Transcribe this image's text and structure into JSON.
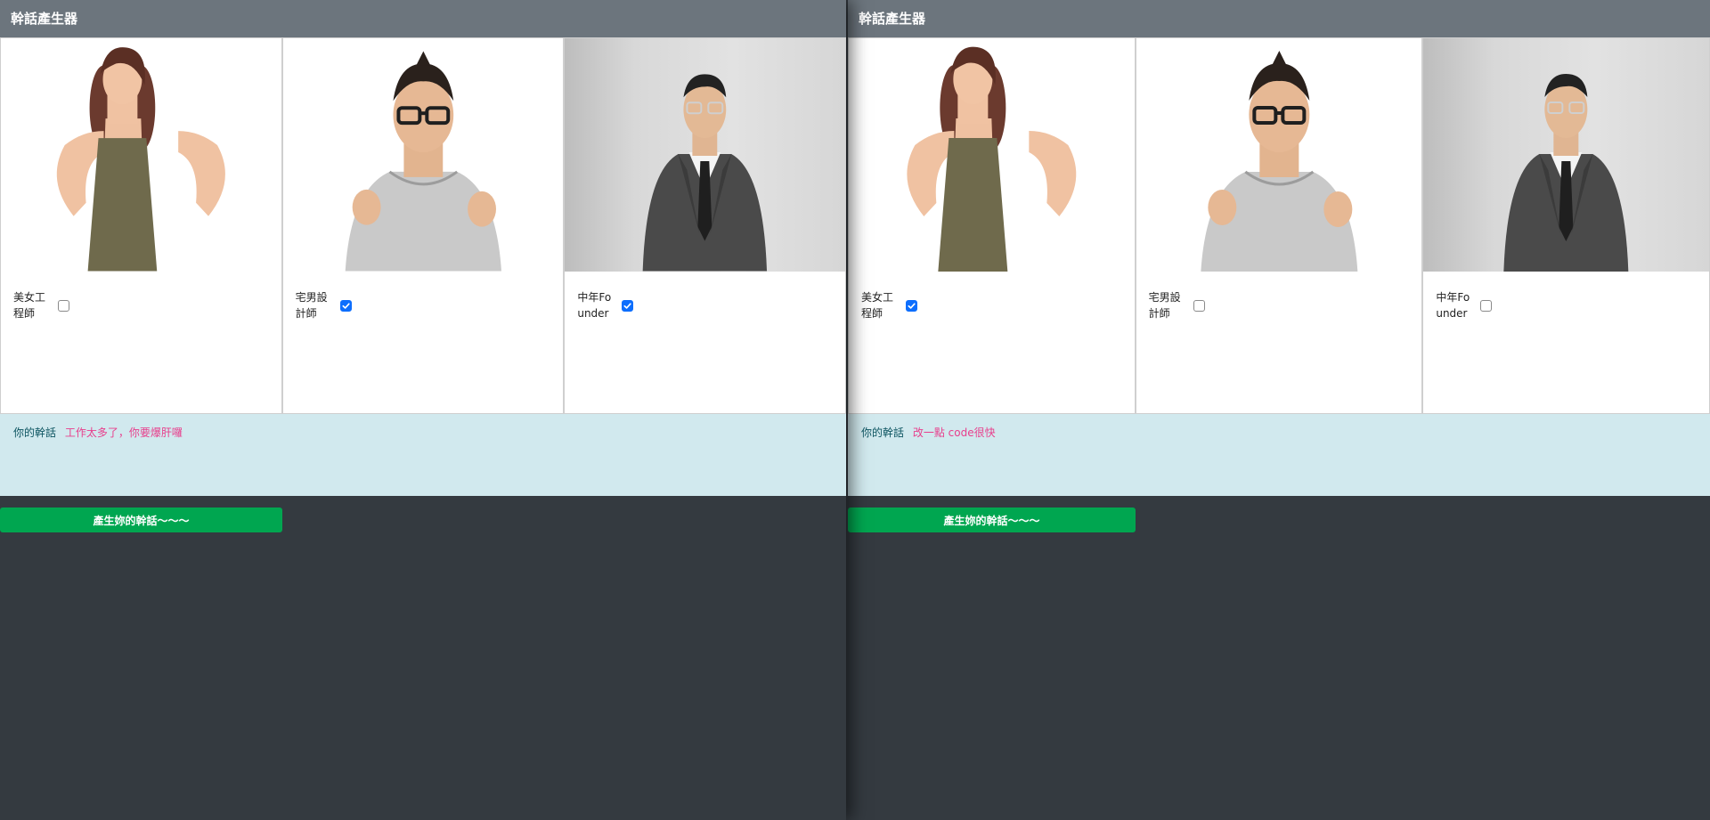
{
  "windows": [
    {
      "title": "幹話產生器",
      "cards": [
        {
          "label": "美女工程師",
          "checked": false,
          "image": "woman-in-apron-photo"
        },
        {
          "label": "宅男設計師",
          "checked": true,
          "image": "man-with-glasses-photo"
        },
        {
          "label": "中年Founder",
          "checked": true,
          "image": "man-in-suit-photo"
        }
      ],
      "result": {
        "label": "你的幹話",
        "text": "工作太多了，你要爆肝囉"
      },
      "button": "產生妳的幹話～～～"
    },
    {
      "title": "幹話產生器",
      "cards": [
        {
          "label": "美女工程師",
          "checked": true,
          "image": "woman-in-apron-photo"
        },
        {
          "label": "宅男設計師",
          "checked": false,
          "image": "man-with-glasses-photo"
        },
        {
          "label": "中年Founder",
          "checked": false,
          "image": "man-in-suit-photo"
        }
      ],
      "result": {
        "label": "你的幹話",
        "text": "改一點 code很快"
      },
      "button": "產生妳的幹話～～～"
    }
  ],
  "colors": {
    "navbar": "#6c757d",
    "background": "#343a40",
    "alert_bg": "#d1e9ee",
    "alert_text": "#e83e8c",
    "button": "#00a650",
    "checkbox_on": "#0d6efd"
  }
}
